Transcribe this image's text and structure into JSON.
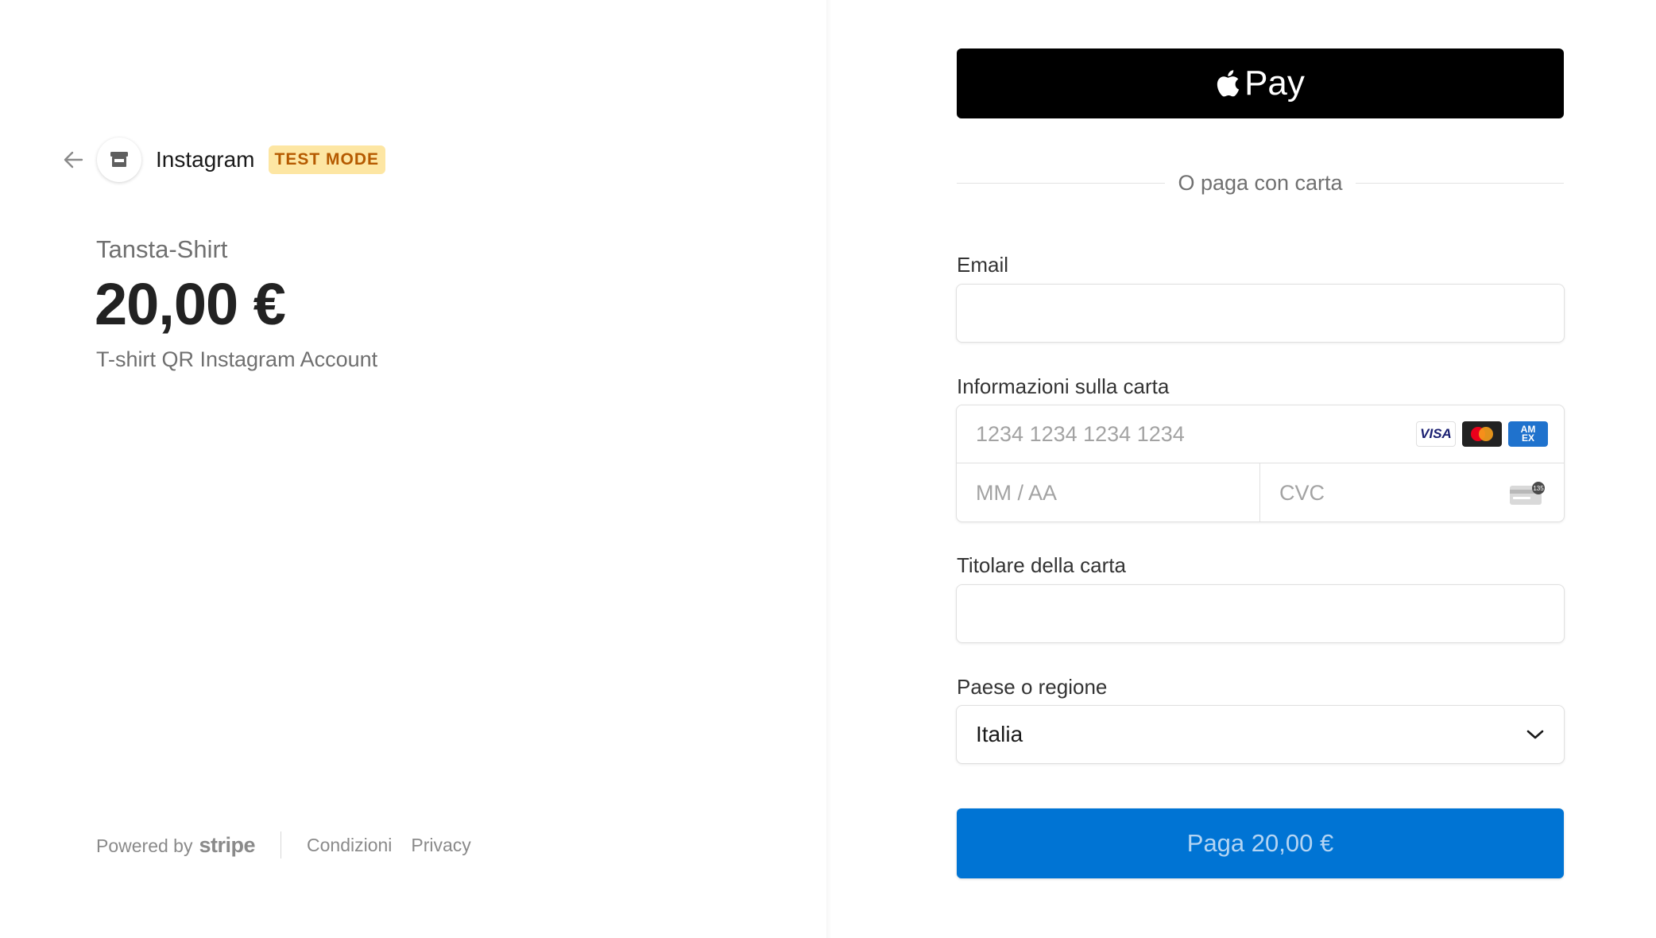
{
  "merchant": {
    "name": "Instagram",
    "badge": "TEST MODE"
  },
  "product": {
    "name": "Tansta-Shirt",
    "price": "20,00 €",
    "description": "T-shirt QR Instagram Account"
  },
  "footer": {
    "powered_by": "Powered by",
    "brand": "stripe",
    "terms": "Condizioni",
    "privacy": "Privacy"
  },
  "payment": {
    "apple_pay_label": "Pay",
    "or_text": "O paga con carta",
    "email_label": "Email",
    "email_value": "",
    "card_label": "Informazioni sulla carta",
    "card_number_placeholder": "1234 1234 1234 1234",
    "expiry_placeholder": "MM / AA",
    "cvc_placeholder": "CVC",
    "card_brands": [
      "VISA",
      "Mastercard",
      "AMEX"
    ],
    "cvc_badge": "135",
    "holder_label": "Titolare della carta",
    "holder_value": "",
    "country_label": "Paese o regione",
    "country_value": "Italia",
    "pay_button": "Paga 20,00 €"
  },
  "colors": {
    "badge_bg": "#fde6a3",
    "badge_text": "#b55a00",
    "pay_button": "#0074d4",
    "apple_pay": "#000000"
  },
  "icons": {
    "back": "arrow-left-icon",
    "store": "store-icon",
    "apple": "apple-logo-icon",
    "chevron": "chevron-down-icon",
    "cvc": "card-cvc-icon"
  }
}
